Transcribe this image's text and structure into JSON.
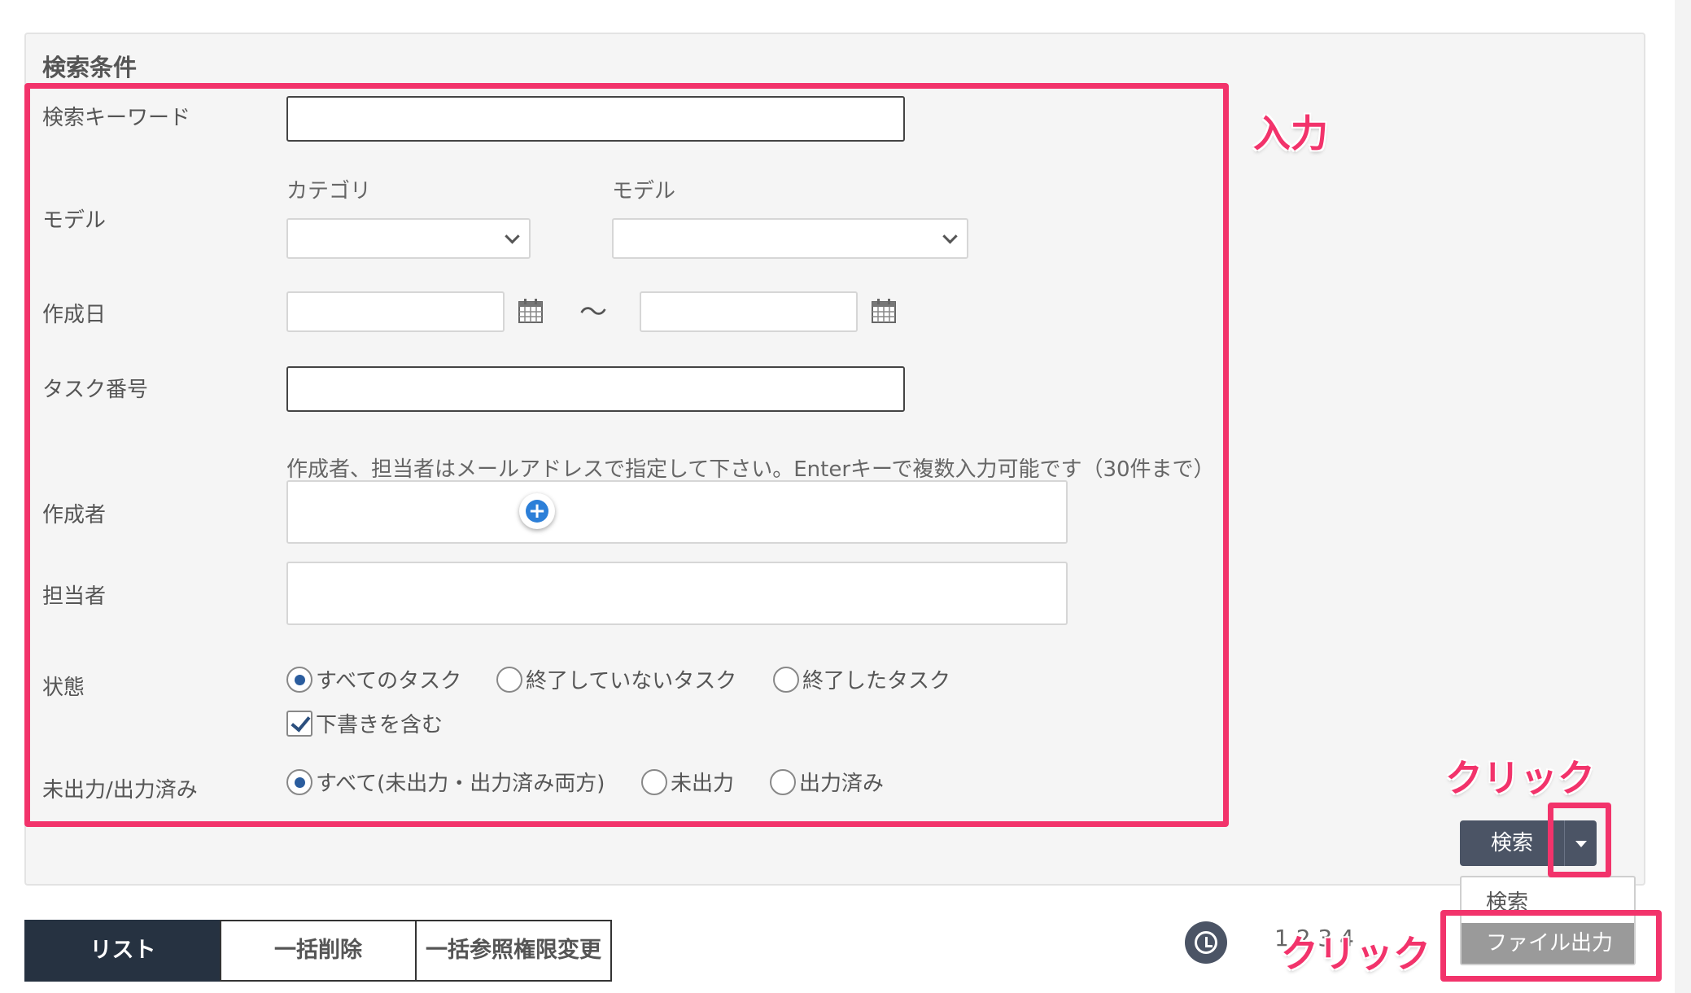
{
  "form": {
    "title": "検索条件",
    "keyword_label": "検索キーワード",
    "keyword_value": "",
    "model_label": "モデル",
    "category_sublabel": "カテゴリ",
    "model_sublabel": "モデル",
    "category_value": "",
    "model_value": "",
    "created_date_label": "作成日",
    "date_separator": "〜",
    "date_from": "",
    "date_to": "",
    "task_number_label": "タスク番号",
    "task_number_value": "",
    "email_hint": "作成者、担当者はメールアドレスで指定して下さい。Enterキーで複数入力可能です（30件まで）",
    "creator_label": "作成者",
    "assignee_label": "担当者",
    "status_label": "状態",
    "status_options": [
      "すべてのタスク",
      "終了していないタスク",
      "終了したタスク"
    ],
    "status_selected": "すべてのタスク",
    "include_draft_label": "下書きを含む",
    "include_draft_checked": true,
    "output_label": "未出力/出力済み",
    "output_options": [
      "すべて(未出力・出力済み両方)",
      "未出力",
      "出力済み"
    ],
    "output_selected": "すべて(未出力・出力済み両方)"
  },
  "actions": {
    "search_label": "検索",
    "dropdown_items": [
      "検索",
      "ファイル出力"
    ],
    "dropdown_highlighted": "ファイル出力"
  },
  "tabs": [
    "リスト",
    "一括削除",
    "一括参照権限変更"
  ],
  "active_tab": "リスト",
  "pager": {
    "text": "1 2 3 4"
  },
  "annotations": {
    "input_note": "入力",
    "click_note_1": "クリック",
    "click_note_2": "クリック"
  },
  "colors": {
    "highlight": "#f2336b",
    "button": "#4b5465",
    "active_tab": "#263241",
    "radio_selected": "#2b5d9e"
  }
}
